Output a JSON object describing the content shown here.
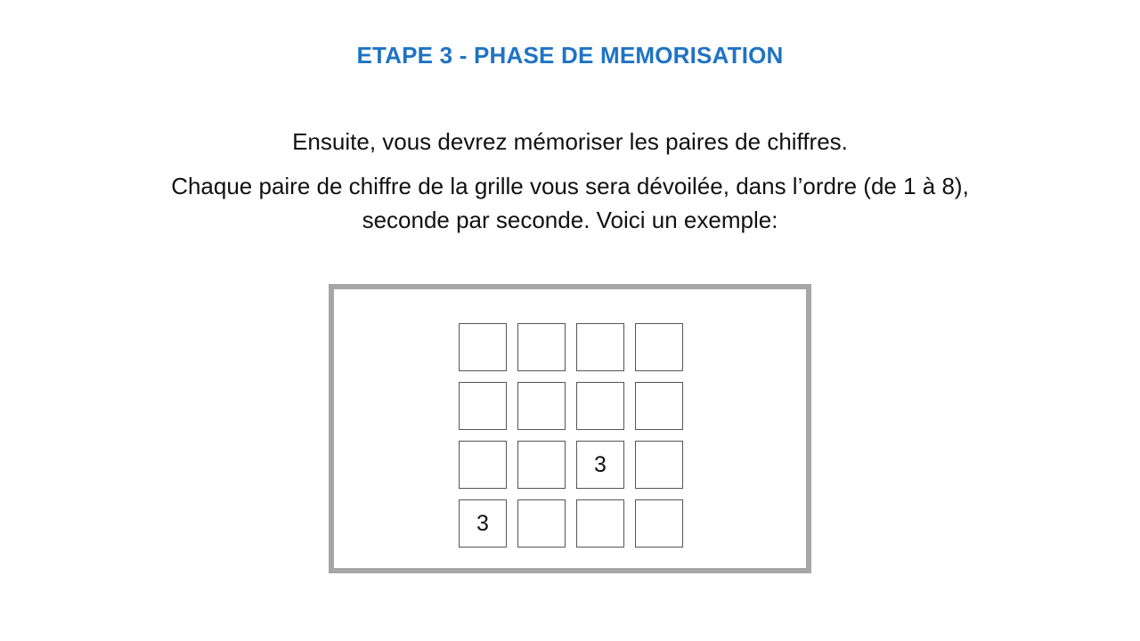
{
  "title": "ETAPE 3 - PHASE DE MEMORISATION",
  "instructions": {
    "line1": "Ensuite, vous devrez mémoriser les paires de chiffres.",
    "line2": "Chaque paire de chiffre de la grille vous sera dévoilée, dans l’ordre (de 1 à 8), seconde par seconde. Voici un exemple:"
  },
  "grid": {
    "rows": 4,
    "cols": 4,
    "cells": [
      [
        "",
        "",
        "",
        ""
      ],
      [
        "",
        "",
        "",
        ""
      ],
      [
        "",
        "",
        "3",
        ""
      ],
      [
        "3",
        "",
        "",
        ""
      ]
    ]
  },
  "colors": {
    "title": "#1f73c4",
    "frame_border": "#a6a6a6",
    "cell_border": "#555555"
  }
}
